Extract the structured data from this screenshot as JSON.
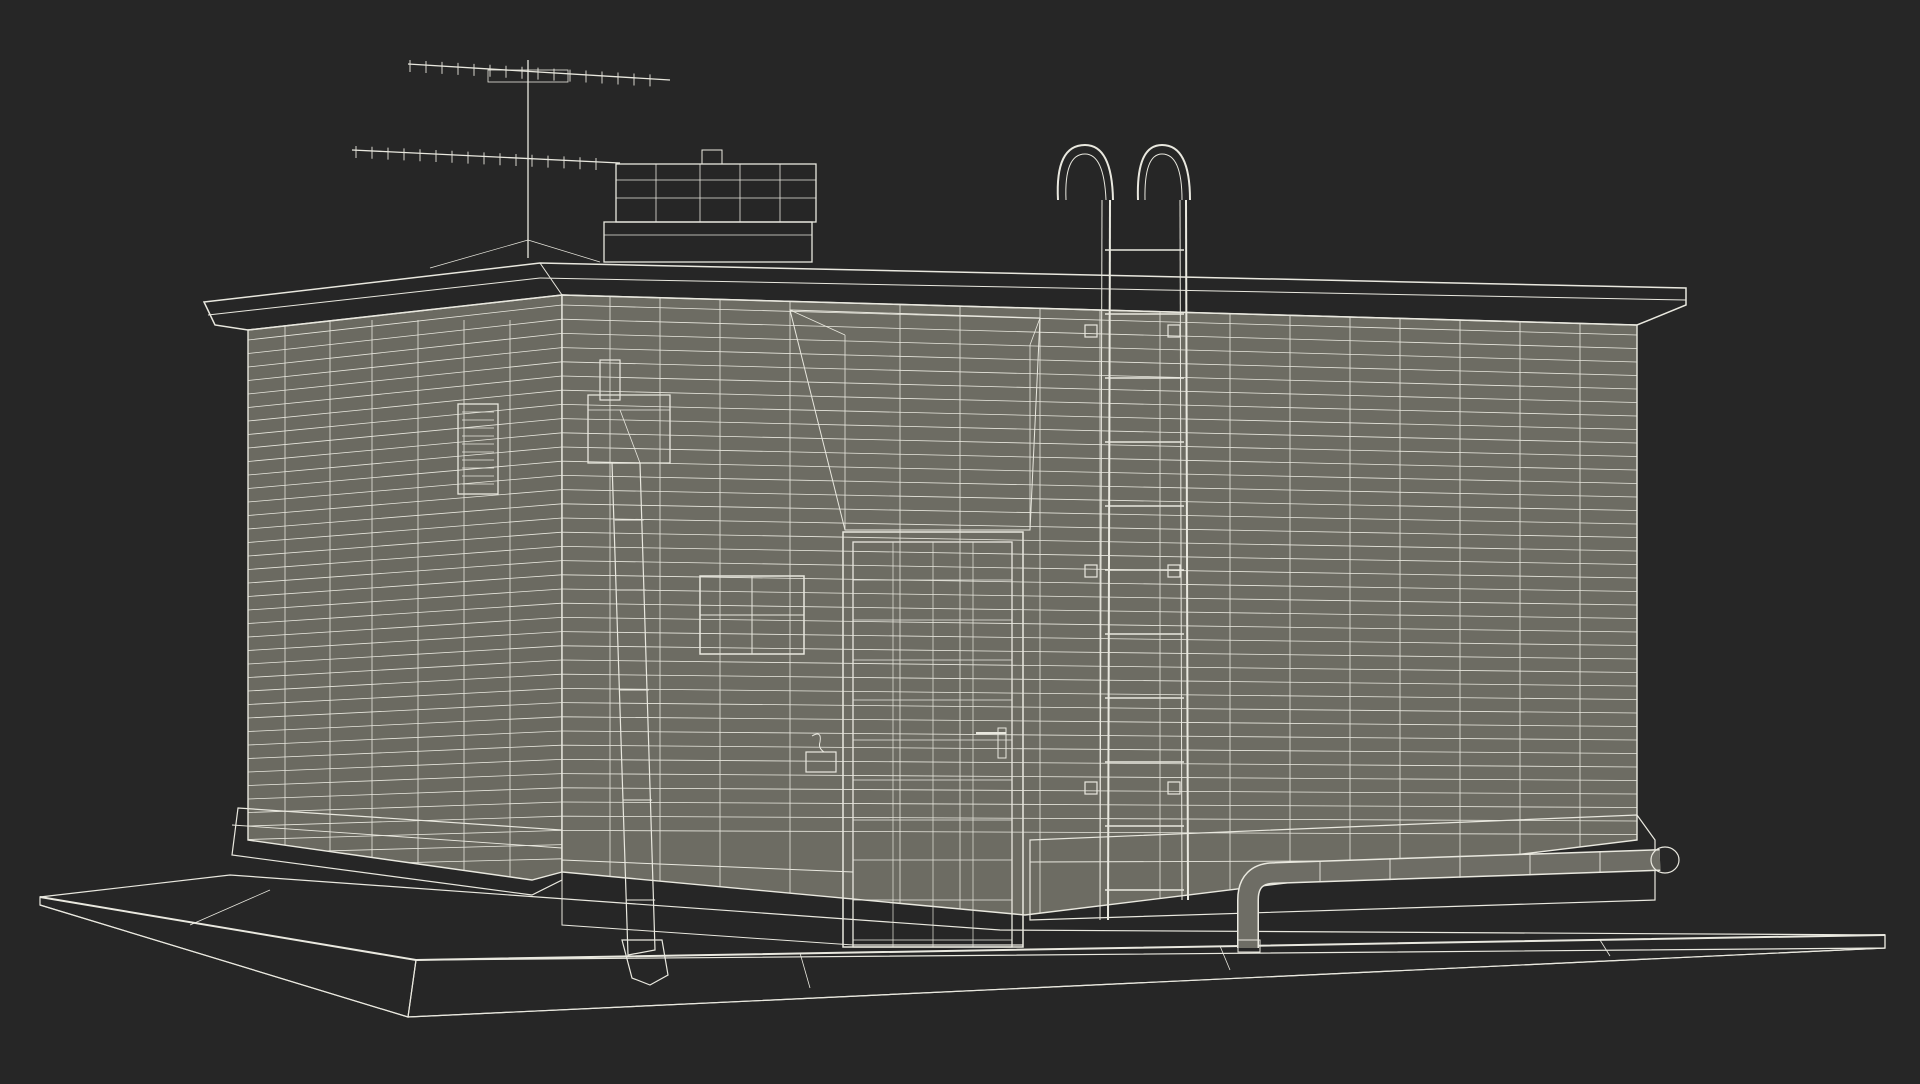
{
  "scene": {
    "background_color": "#262626",
    "surface_color": "#6b6a61",
    "wire_color": "#e9e8df"
  }
}
